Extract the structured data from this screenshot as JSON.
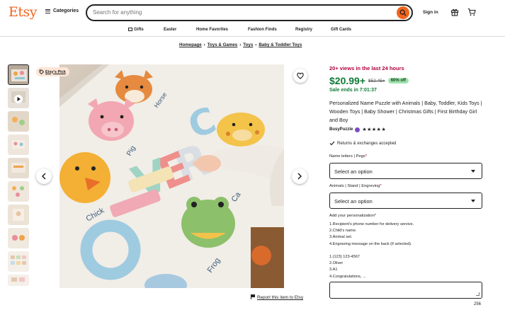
{
  "header": {
    "logo": "Etsy",
    "categories_label": "Categories",
    "search_placeholder": "Search for anything",
    "signin_label": "Sign in"
  },
  "subnav": [
    "Gifts",
    "Easter",
    "Home Favorites",
    "Fashion Finds",
    "Registry",
    "Gift Cards"
  ],
  "breadcrumb": [
    "Homepage",
    "Toys & Games",
    "Toys",
    "Baby & Toddler Toys"
  ],
  "media": {
    "badge": "Etsy's Pick",
    "report_link": "Report this item to Etsy",
    "thumbnail_count": 10
  },
  "listing": {
    "views": "20+ views in the last 24 hours",
    "price": "$20.99+",
    "old_price": "$52.45+",
    "discount": "60% off",
    "sale_text": "Sale ends in 7:01:37",
    "title": "Personalized Name Puzzle with Animals | Baby, Toddler, Kids Toys | Wooden Toys | Baby Shower | Christmas Gifts | First Birthday Girl and Boy",
    "shop_name": "BusyPuzzle",
    "rating_stars": "★★★★★",
    "returns": "Returns & exchanges accepted"
  },
  "options": [
    {
      "label": "Name letters | Pegs",
      "required": "*",
      "value": "Select an option"
    },
    {
      "label": "Animals | Stand | Engreving",
      "required": "*",
      "value": "Select an option"
    }
  ],
  "personalization": {
    "label": "Add your personalization",
    "required": "*",
    "instructions": "1.Recipient's phone number for delivery service.\n2.Child's name.\n3.Animal set.\n4.Engraving message on the back (if selected).\n\n1.(123) 123-4567\n2.Oliver\n3.A1\n4.Congratulations, ...",
    "char_count": "256"
  },
  "colors": {
    "brand": "#f1641e",
    "price": "#0e7a35",
    "views": "#b3003a",
    "discount_bg": "#9ee3ac"
  }
}
